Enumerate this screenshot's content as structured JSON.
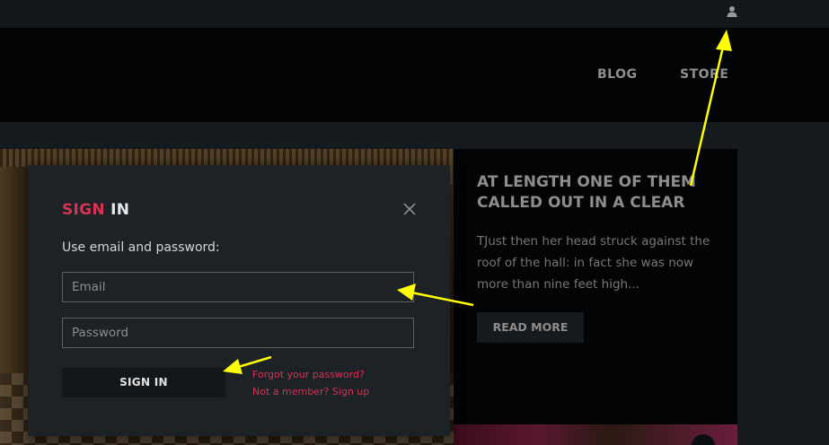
{
  "topbar": {
    "user_icon": "user-icon"
  },
  "nav": {
    "items": [
      {
        "label": "BLOG"
      },
      {
        "label": "STORE"
      }
    ]
  },
  "article": {
    "title": "AT LENGTH ONE OF THEM CALLED OUT IN A CLEAR",
    "excerpt": "TJust then her head struck against the roof of the hall: in fact she was now more than nine feet high...",
    "read_more_label": "READ MORE"
  },
  "modal": {
    "title_accent": "SIGN",
    "title_rest": "IN",
    "subtitle": "Use email and password:",
    "email_placeholder": "Email",
    "password_placeholder": "Password",
    "submit_label": "SIGN IN",
    "forgot_label": "Forgot your password?",
    "signup_label": "Not a member? Sign up",
    "close_icon": "close-icon"
  },
  "colors": {
    "accent": "#d73353",
    "annotation_arrow": "#ffff00",
    "header_bg": "#030405",
    "modal_bg": "#1c2226"
  }
}
